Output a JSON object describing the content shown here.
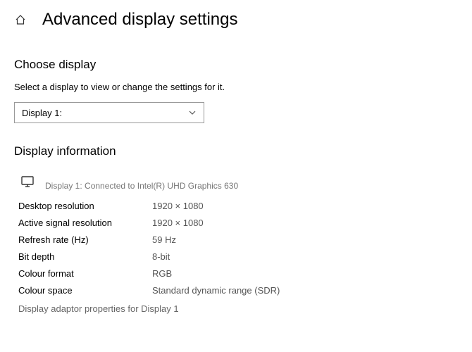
{
  "header": {
    "title": "Advanced display settings"
  },
  "choose": {
    "heading": "Choose display",
    "subtext": "Select a display to view or change the settings for it.",
    "dropdown_value": "Display 1:"
  },
  "info": {
    "heading": "Display information",
    "monitor_caption": "Display 1: Connected to Intel(R) UHD Graphics 630",
    "rows": [
      {
        "label": "Desktop resolution",
        "value": "1920 × 1080"
      },
      {
        "label": "Active signal resolution",
        "value": "1920 × 1080"
      },
      {
        "label": "Refresh rate (Hz)",
        "value": "59 Hz"
      },
      {
        "label": "Bit depth",
        "value": "8-bit"
      },
      {
        "label": "Colour format",
        "value": "RGB"
      },
      {
        "label": "Colour space",
        "value": "Standard dynamic range (SDR)"
      }
    ],
    "link": "Display adaptor properties for Display 1"
  }
}
